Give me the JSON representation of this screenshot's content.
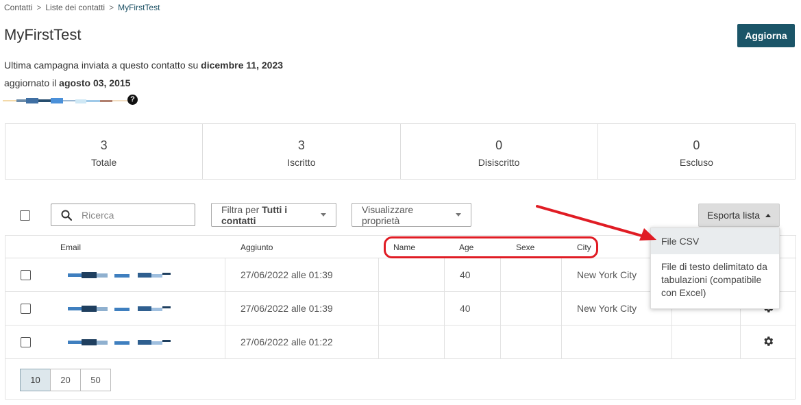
{
  "breadcrumb": {
    "items": [
      "Contatti",
      "Liste dei contatti"
    ],
    "separator": ">",
    "current": "MyFirstTest"
  },
  "page": {
    "title": "MyFirstTest",
    "refresh_label": "Aggiorna",
    "last_campaign_prefix": "Ultima campagna inviata a questo contatto su",
    "last_campaign_date": "dicembre 11, 2023",
    "updated_prefix": "aggiornato il",
    "updated_date": "agosto 03, 2015",
    "help_symbol": "?"
  },
  "stats": [
    {
      "value": "3",
      "label": "Totale"
    },
    {
      "value": "3",
      "label": "Iscritto"
    },
    {
      "value": "0",
      "label": "Disiscritto"
    },
    {
      "value": "0",
      "label": "Escluso"
    }
  ],
  "toolbar": {
    "search_placeholder": "Ricerca",
    "filter_prefix": "Filtra per",
    "filter_value": "Tutti i contatti",
    "properties_label": "Visualizzare proprietà",
    "export_label": "Esporta lista"
  },
  "table": {
    "headers": {
      "email": "Email",
      "added": "Aggiunto",
      "name": "Name",
      "age": "Age",
      "sexe": "Sexe",
      "city": "City"
    },
    "rows": [
      {
        "added": "27/06/2022 alle 01:39",
        "name": "",
        "age": "40",
        "sexe": "",
        "city": "New York City"
      },
      {
        "added": "27/06/2022 alle 01:39",
        "name": "",
        "age": "40",
        "sexe": "",
        "city": "New York City"
      },
      {
        "added": "27/06/2022 alle 01:22",
        "name": "",
        "age": "",
        "sexe": "",
        "city": ""
      }
    ]
  },
  "pagination": {
    "options": [
      "10",
      "20",
      "50"
    ],
    "selected": "10"
  },
  "export_menu": {
    "items": [
      "File CSV",
      "File di testo delimitato da tabulazioni (compatibile con Excel)"
    ]
  },
  "icons": {
    "search": "search-icon",
    "settings": "gear-icon",
    "help": "question-circle-icon",
    "caret_down": "caret-down-icon",
    "caret_up": "caret-up-icon"
  },
  "colors": {
    "primary_button": "#1b5568",
    "annotation_red": "#e01c24",
    "active_page_bg": "#dde7ec"
  }
}
